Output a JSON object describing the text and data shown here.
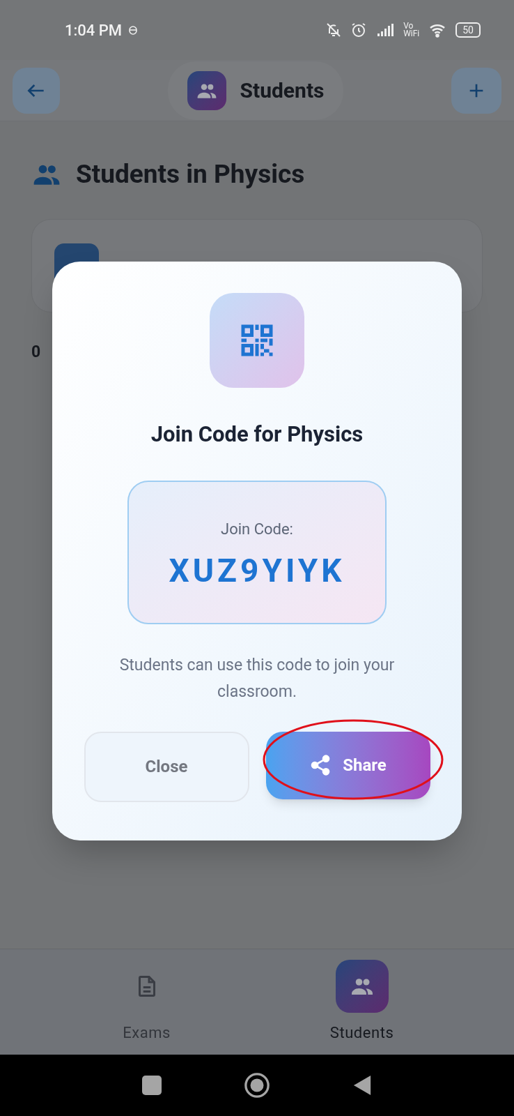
{
  "status_bar": {
    "time": "1:04 PM",
    "calling_top": "Vo",
    "calling_bottom": "WiFi",
    "battery": "50"
  },
  "header": {
    "title": "Students"
  },
  "heading": "Students in Physics",
  "count_text": "0",
  "dialog": {
    "title": "Join Code for Physics",
    "code_label": "Join Code:",
    "code": "XUZ9YIYK",
    "description": "Students can use this code to join your classroom.",
    "buttons": [
      {
        "label": "Close",
        "kind": "outline"
      },
      {
        "label": "Share",
        "kind": "primary"
      }
    ]
  },
  "highlight": true,
  "bottom_nav": [
    {
      "label": "Exams",
      "kind": "document",
      "selected": false
    },
    {
      "label": "Students",
      "kind": "people",
      "selected": true
    }
  ]
}
